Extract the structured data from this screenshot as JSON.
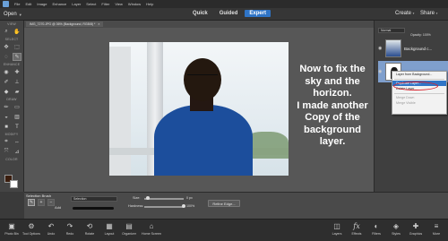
{
  "menubar": {
    "items": [
      "File",
      "Edit",
      "Image",
      "Enhance",
      "Layer",
      "Select",
      "Filter",
      "View",
      "Window",
      "Help"
    ]
  },
  "modebar": {
    "open_label": "Open",
    "tabs": [
      "Quick",
      "Guided",
      "Expert"
    ],
    "active_tab": "Expert",
    "create_label": "Create",
    "share_label": "Share"
  },
  "document": {
    "tab_name": "IMG_7270.JPG @ 36% (Background, RGB/8) *",
    "close_glyph": "×"
  },
  "toolbar": {
    "sections": [
      "VIEW",
      "SELECT",
      "ENHANCE",
      "DRAW",
      "MODIFY",
      "COLOR"
    ]
  },
  "canvas": {
    "caption_lines": [
      "Now to fix the",
      "sky and the",
      "horizon.",
      "I made another",
      "Copy of the",
      "background",
      "layer."
    ]
  },
  "layers": {
    "blend_mode": "Normal",
    "opacity_label": "Opacity:",
    "opacity_value": "100%",
    "rows": [
      {
        "name": "Background c..."
      },
      {
        "name": ""
      }
    ]
  },
  "context_menu": {
    "items": [
      {
        "label": "Layer from Background...",
        "state": "normal"
      },
      {
        "label": "Duplicate Layer...",
        "state": "highlighted"
      },
      {
        "label": "Delete Layer",
        "state": "normal"
      },
      {
        "label": "Merge Down",
        "state": "dim"
      },
      {
        "label": "Merge Visible",
        "state": "dim"
      }
    ]
  },
  "tool_options": {
    "title": "Selection Brush",
    "add_label": "Add",
    "mode_select": "Selection",
    "size_label": "Size:",
    "size_value": "0 px",
    "hardness_label": "Hardness:",
    "hardness_value": "100%",
    "refine_label": "Refine Edge..."
  },
  "taskbar": {
    "items": [
      {
        "label": "Photo Bin",
        "icon": "photo-bin-icon",
        "glyph": "▣"
      },
      {
        "label": "Tool Options",
        "icon": "tool-options-icon",
        "glyph": "⚙"
      },
      {
        "label": "Undo",
        "icon": "undo-icon",
        "glyph": "↶"
      },
      {
        "label": "Redo",
        "icon": "redo-icon",
        "glyph": "↷"
      },
      {
        "label": "Rotate",
        "icon": "rotate-icon",
        "glyph": "⟲"
      },
      {
        "label": "Layout",
        "icon": "layout-icon",
        "glyph": "▦"
      },
      {
        "label": "Organizer",
        "icon": "organizer-icon",
        "glyph": "▤"
      },
      {
        "label": "Home Screen",
        "icon": "home-icon",
        "glyph": "⌂"
      },
      {
        "label": "Layers",
        "icon": "layers-icon",
        "glyph": "◫"
      },
      {
        "label": "Effects",
        "icon": "effects-icon",
        "glyph": "fx"
      },
      {
        "label": "Filters",
        "icon": "filters-icon",
        "glyph": "◐"
      },
      {
        "label": "Styles",
        "icon": "styles-icon",
        "glyph": "◈"
      },
      {
        "label": "Graphics",
        "icon": "graphics-icon",
        "glyph": "✚"
      },
      {
        "label": "More",
        "icon": "more-icon",
        "glyph": "≡"
      }
    ]
  },
  "colors": {
    "accent": "#2f74c6",
    "foreground_swatch": "#3a1d0e",
    "background_swatch": "#ffffff",
    "annotation_circle": "#d8202a"
  }
}
